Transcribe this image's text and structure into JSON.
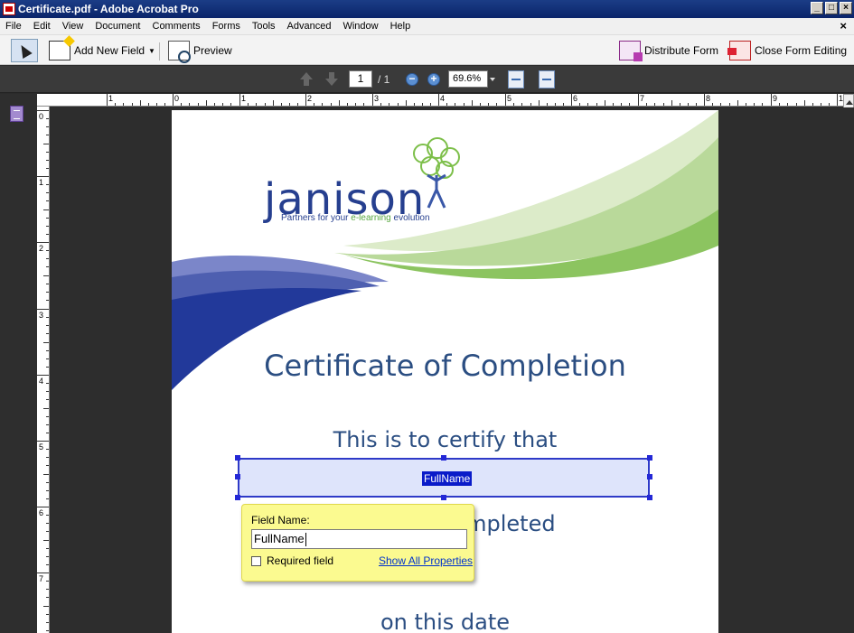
{
  "window": {
    "title": "Certificate.pdf - Adobe Acrobat Pro"
  },
  "menu": [
    "File",
    "Edit",
    "View",
    "Document",
    "Comments",
    "Forms",
    "Tools",
    "Advanced",
    "Window",
    "Help"
  ],
  "toolbar": {
    "add_field_label": "Add New Field",
    "preview_label": "Preview",
    "distribute_label": "Distribute Form",
    "close_editing_label": "Close Form Editing"
  },
  "nav": {
    "current_page": "1",
    "total_pages": "/ 1",
    "zoom": "69.6%"
  },
  "ruler": {
    "h_labels": [
      "1",
      "0",
      "1",
      "2",
      "3",
      "4",
      "5",
      "6",
      "7",
      "8",
      "9",
      "1"
    ],
    "v_labels": [
      "0",
      "1",
      "2",
      "3",
      "4",
      "5",
      "6",
      "7"
    ]
  },
  "document": {
    "logo_text": "janison",
    "tagline_blue": "Partners for your ",
    "tagline_green": "e-learning",
    "tagline_rest": " evolution",
    "title": "Certificate of Completion",
    "certify_line": "This is to certify that",
    "completed_line": "ompleted",
    "date_line": "on this date",
    "colors": {
      "title_blue": "#2b4e82",
      "logo_blue": "#263f8f",
      "green": "#7dbf4a",
      "field_fill": "#dee4fb"
    }
  },
  "form_field": {
    "name": "FullName"
  },
  "popup": {
    "field_name_label": "Field Name:",
    "field_name_value": "FullName",
    "required_label": "Required field",
    "required_checked": false,
    "show_all_label": "Show All Properties"
  }
}
